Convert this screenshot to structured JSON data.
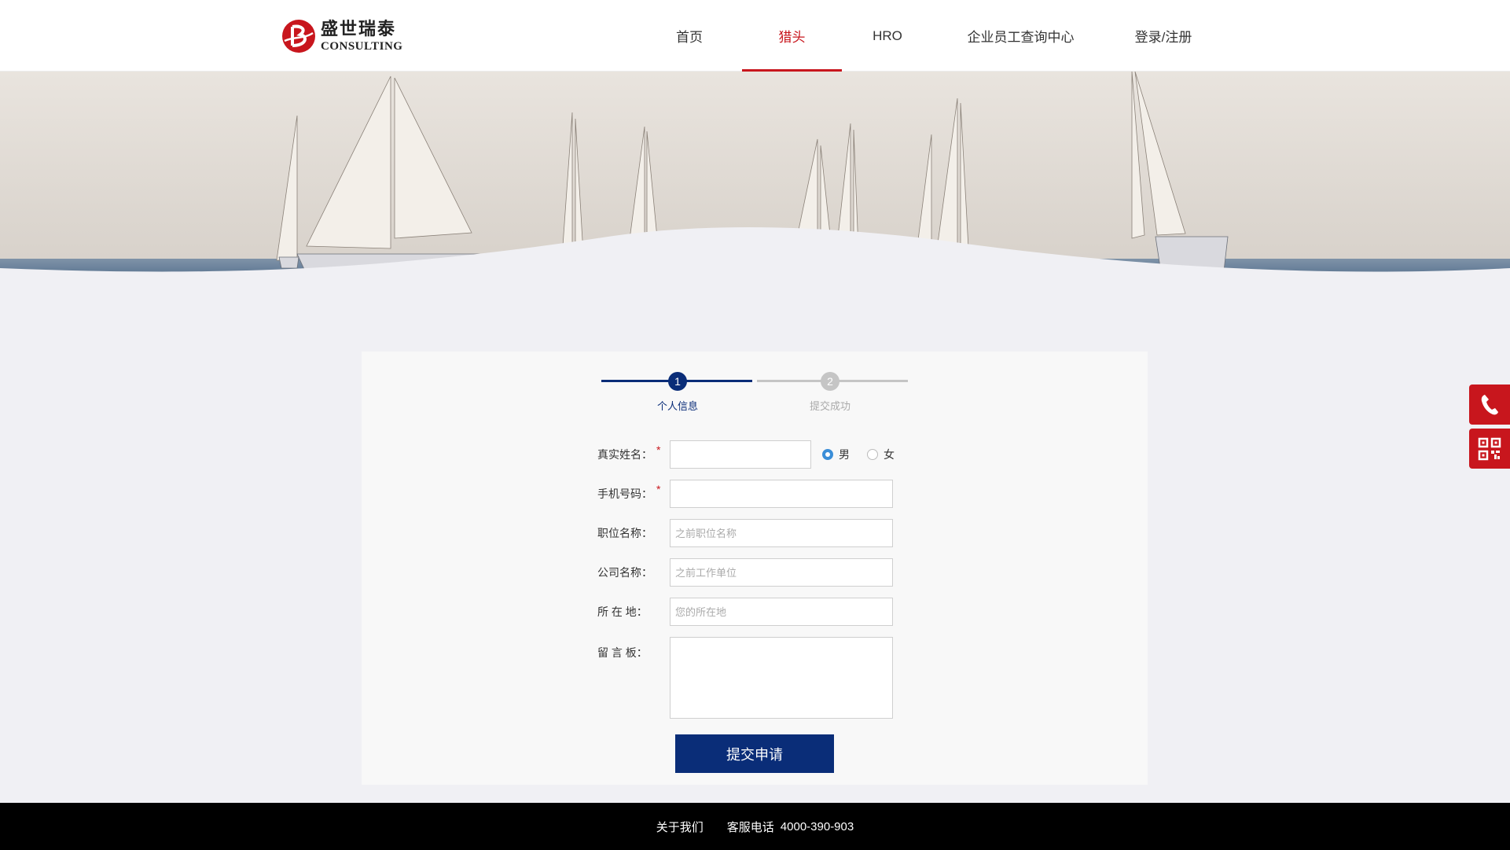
{
  "brand": {
    "name_cn": "盛世瑞泰",
    "name_en": "CONSULTING",
    "accent": "#c8161d",
    "primary": "#0a2d78"
  },
  "nav": {
    "items": [
      {
        "label": "首页",
        "active": false
      },
      {
        "label": "猎头",
        "active": true
      },
      {
        "label": "HRO",
        "active": false
      },
      {
        "label": "企业员工查询中心",
        "active": false
      },
      {
        "label": "登录/注册",
        "active": false
      }
    ]
  },
  "steps": [
    {
      "number": "1",
      "label": "个人信息",
      "status": "current"
    },
    {
      "number": "2",
      "label": "提交成功",
      "status": "pending"
    }
  ],
  "form": {
    "name": {
      "label": "真实姓名：",
      "required": true,
      "value": ""
    },
    "gender": {
      "options": [
        "男",
        "女"
      ],
      "selected": "男"
    },
    "phone": {
      "label": "手机号码：",
      "required": true,
      "value": ""
    },
    "position": {
      "label": "职位名称：",
      "placeholder": "之前职位名称"
    },
    "company": {
      "label": "公司名称：",
      "placeholder": "之前工作单位"
    },
    "location": {
      "label": "所 在 地：",
      "placeholder": "您的所在地"
    },
    "message": {
      "label": "留 言 板："
    },
    "required_mark": "*",
    "submit_label": "提交申请"
  },
  "side_tools": [
    {
      "icon": "phone-icon"
    },
    {
      "icon": "qr-code-icon"
    }
  ],
  "footer": {
    "about": "关于我们",
    "hotline_label": "客服电话",
    "hotline": "4000-390-903"
  }
}
